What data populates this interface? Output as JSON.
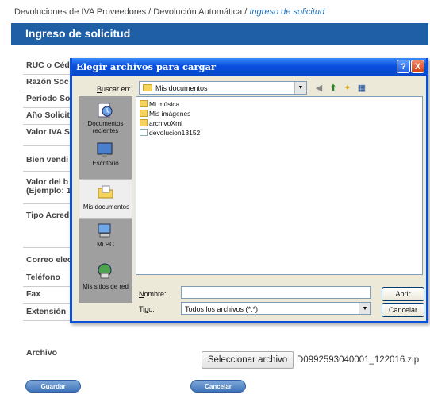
{
  "page": {
    "breadcrumb": {
      "part1": "Devoluciones de IVA Proveedores",
      "sep1": " / ",
      "part2": "Devolución Automática",
      "sep2": " / ",
      "current": "Ingreso de solicitud"
    },
    "title": "Ingreso de solicitud",
    "form_labels": {
      "ruc": "RUC o Céd",
      "razon": "Razón Soc",
      "periodo": "Período So",
      "anio": "Año Solicit",
      "valor_iva": "Valor IVA S",
      "bien": "Bien vendi",
      "valor_bien": "Valor del b (Ejemplo: 1",
      "tipo": "Tipo Acred",
      "correo": "Correo elec",
      "telefono": "Teléfono",
      "fax": "Fax",
      "extension": "Extensión"
    },
    "archivo_label": "Archivo",
    "select_file_button": "Seleccionar archivo",
    "selected_file": "D0992593040001_122016.zip",
    "save_button": "Guardar",
    "cancel_button": "Cancelar"
  },
  "dialog": {
    "title": "Elegir archivos para cargar",
    "help": "?",
    "close": "X",
    "look_in_label": "Buscar en:",
    "look_in_value": "Mis documentos",
    "places": [
      {
        "label": "Documentos recientes",
        "icon": "recent-documents-icon"
      },
      {
        "label": "Escritorio",
        "icon": "desktop-icon"
      },
      {
        "label": "Mis documentos",
        "icon": "my-documents-icon"
      },
      {
        "label": "Mi PC",
        "icon": "my-computer-icon"
      },
      {
        "label": "Mis sitios de red",
        "icon": "network-places-icon"
      }
    ],
    "files": [
      {
        "name": "Mi música",
        "kind": "folder"
      },
      {
        "name": "Mis imágenes",
        "kind": "folder"
      },
      {
        "name": "archivoXml",
        "kind": "folder"
      },
      {
        "name": "devolucion13152",
        "kind": "document"
      }
    ],
    "name_label": "Nombre:",
    "name_value": "",
    "type_label": "Tipo:",
    "type_value": "Todos los archivos (*.*)",
    "open_button": "Abrir",
    "cancel_button": "Cancelar"
  }
}
